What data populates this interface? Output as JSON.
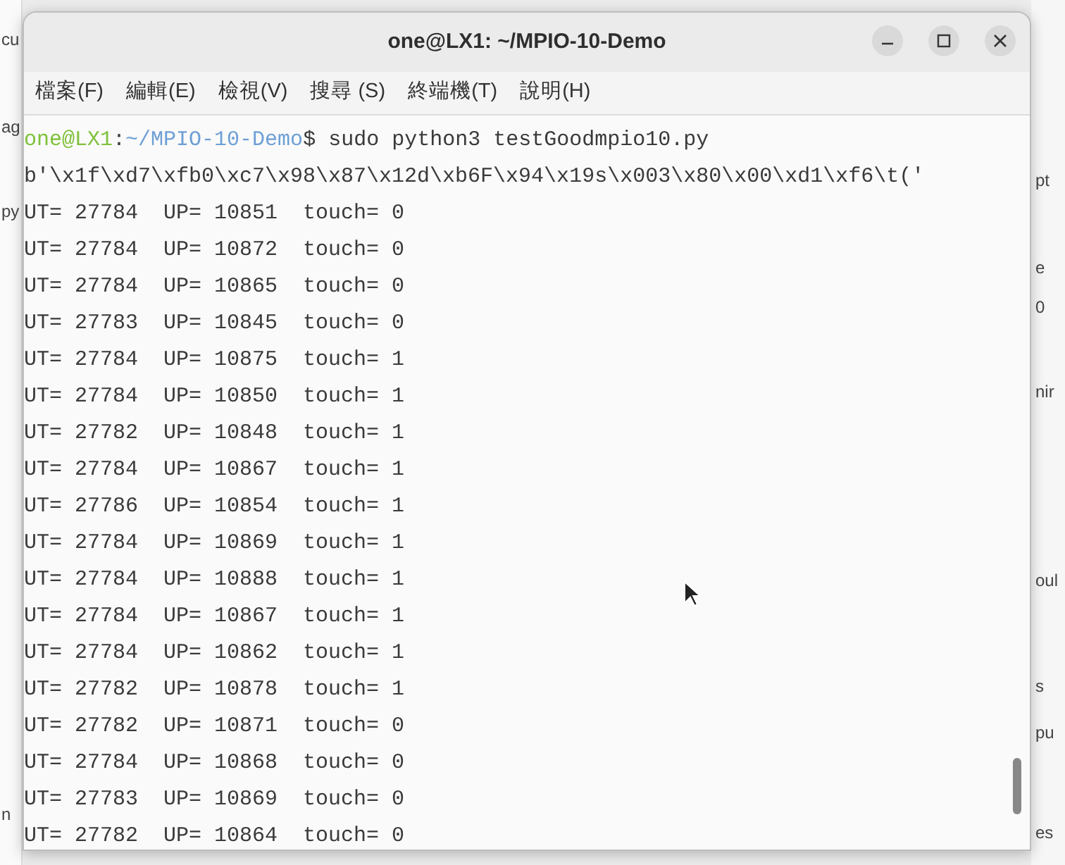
{
  "background_left_fragments": [
    "cu",
    "ag",
    "py",
    "n"
  ],
  "background_right_fragments": [
    "pt",
    "e",
    "0",
    "nir",
    "oul",
    "s",
    "pu",
    "es"
  ],
  "window": {
    "title": "one@LX1: ~/MPIO-10-Demo"
  },
  "menu": [
    "檔案(F)",
    "編輯(E)",
    "檢視(V)",
    "搜尋 (S)",
    "終端機(T)",
    "說明(H)"
  ],
  "terminal": {
    "prompt": {
      "user_host": "one@LX1",
      "separator": ":",
      "path": "~/MPIO-10-Demo",
      "command": "$ sudo python3 testGoodmpio10.py"
    },
    "lines": [
      "b'\\x1f\\xd7\\xfb0\\xc7\\x98\\x87\\x12d\\xb6F\\x94\\x19s\\x003\\x80\\x00\\xd1\\xf6\\t('",
      "UT= 27784  UP= 10851  touch= 0",
      "UT= 27784  UP= 10872  touch= 0",
      "UT= 27784  UP= 10865  touch= 0",
      "UT= 27783  UP= 10845  touch= 0",
      "UT= 27784  UP= 10875  touch= 1",
      "UT= 27784  UP= 10850  touch= 1",
      "UT= 27782  UP= 10848  touch= 1",
      "UT= 27784  UP= 10867  touch= 1",
      "UT= 27786  UP= 10854  touch= 1",
      "UT= 27784  UP= 10869  touch= 1",
      "UT= 27784  UP= 10888  touch= 1",
      "UT= 27784  UP= 10867  touch= 1",
      "UT= 27784  UP= 10862  touch= 1",
      "UT= 27782  UP= 10878  touch= 1",
      "UT= 27782  UP= 10871  touch= 0",
      "UT= 27784  UP= 10868  touch= 0",
      "UT= 27783  UP= 10869  touch= 0",
      "UT= 27782  UP= 10864  touch= 0"
    ]
  }
}
